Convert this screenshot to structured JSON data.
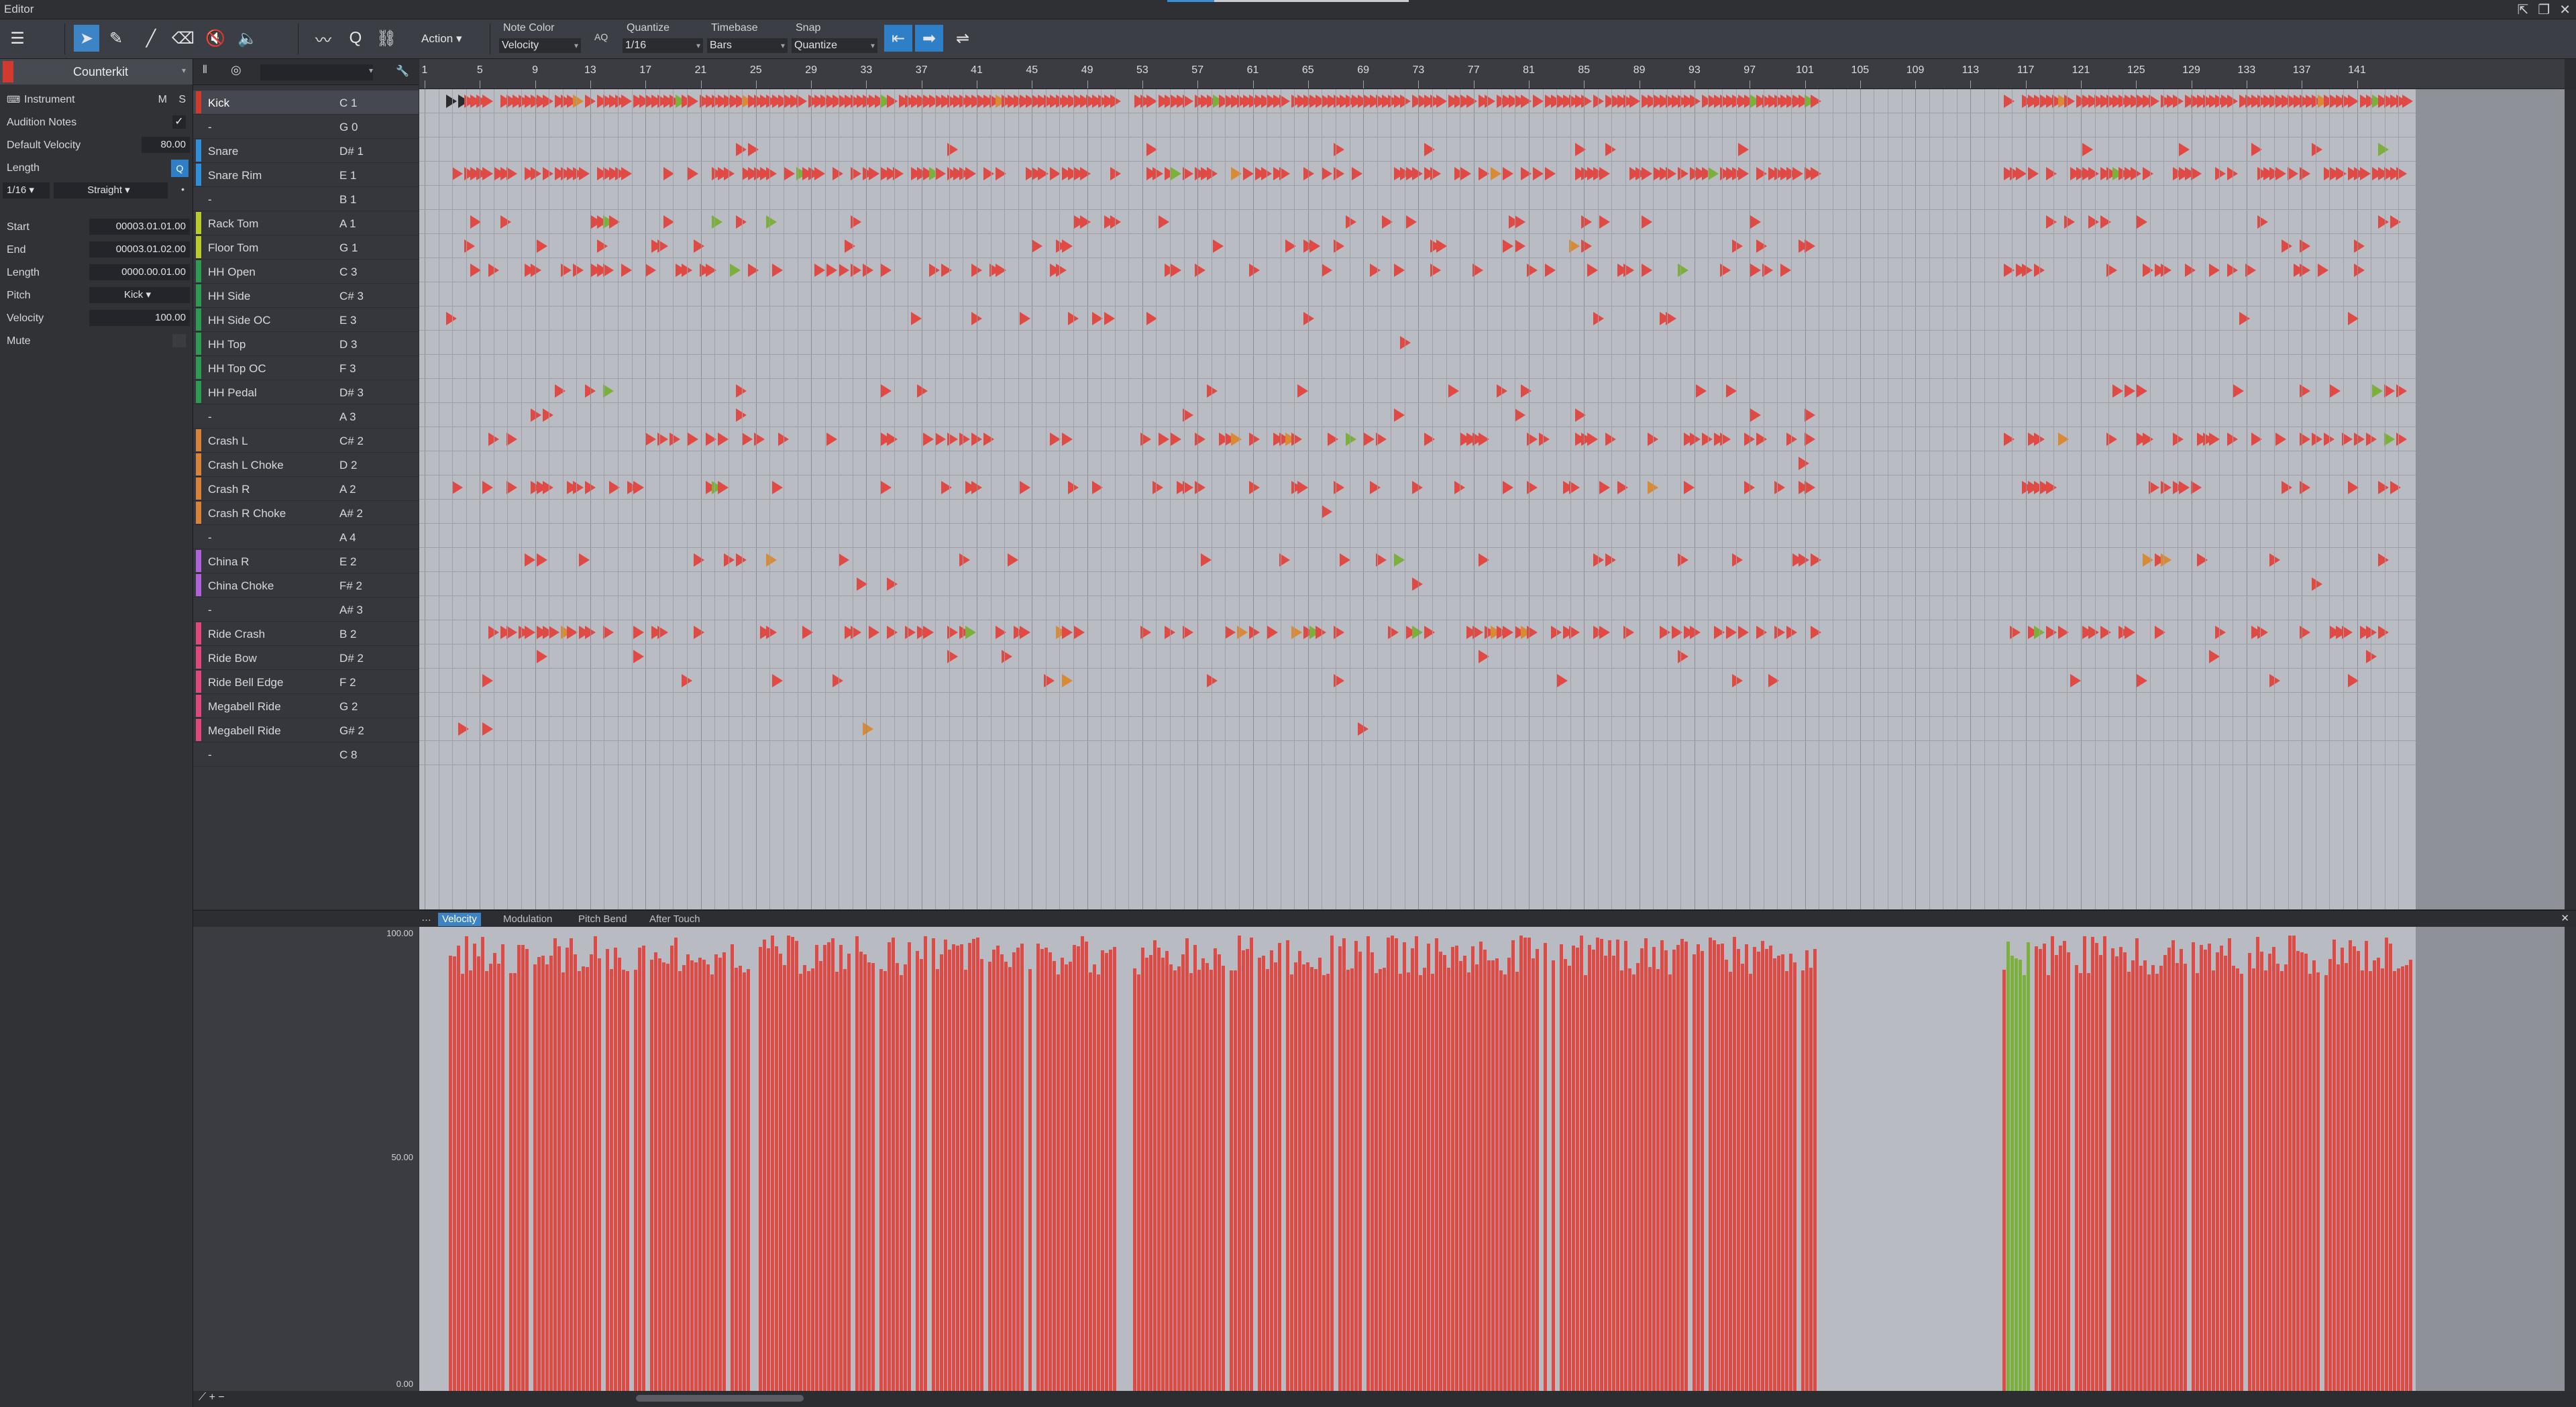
{
  "window": {
    "title": "Editor",
    "controls": [
      "pin-icon",
      "restore-icon",
      "close-icon"
    ]
  },
  "toolbar": {
    "tools": [
      "menu-icon",
      "arrow-tool-icon",
      "pencil-tool-icon",
      "paint-tool-icon",
      "eraser-tool-icon",
      "mute-tool-icon",
      "listen-tool-icon",
      "bend-tool-icon",
      "quantize-icon",
      "split-icon"
    ],
    "action_label": "Action",
    "note_color_label": "Note Color",
    "note_color_value": "Velocity",
    "quantize_badge": "AQ",
    "quantize_label": "Quantize",
    "quantize_value": "1/16",
    "timebase_label": "Timebase",
    "timebase_value": "Bars",
    "snap_label": "Snap",
    "snap_value": "Quantize"
  },
  "inspector": {
    "instrument_name": "Counterkit",
    "instrument_label": "Instrument",
    "m_label": "M",
    "s_label": "S",
    "audition_notes_label": "Audition Notes",
    "default_velocity_label": "Default Velocity",
    "default_velocity_value": "80.00",
    "length_label": "Length",
    "length_grid": "1/16",
    "length_mode": "Straight",
    "start_label": "Start",
    "start_value": "00003.01.01.00",
    "end_label": "End",
    "end_value": "00003.01.02.00",
    "note_length_label": "Length",
    "note_length_value": "0000.00.01.00",
    "pitch_label": "Pitch",
    "pitch_value": "Kick",
    "velocity_label": "Velocity",
    "velocity_value": "100.00",
    "mute_label": "Mute"
  },
  "colors": {
    "accent": "#3c84c6",
    "note": "#e04a45",
    "note_green": "#7bb03a",
    "note_orange": "#d88a34",
    "note_blue": "#6a6ee0"
  },
  "lanes": [
    {
      "name": "Kick",
      "pitch": "C 1",
      "color": "#d23a2e"
    },
    {
      "name": "-",
      "pitch": "G 0",
      "color": ""
    },
    {
      "name": "Snare",
      "pitch": "D# 1",
      "color": "#2f8fd8"
    },
    {
      "name": "Snare Rim",
      "pitch": "E 1",
      "color": "#2f8fd8"
    },
    {
      "name": "-",
      "pitch": "B 1",
      "color": ""
    },
    {
      "name": "Rack Tom",
      "pitch": "A 1",
      "color": "#b9cc2a"
    },
    {
      "name": "Floor Tom",
      "pitch": "G 1",
      "color": "#b9cc2a"
    },
    {
      "name": "HH Open",
      "pitch": "C 3",
      "color": "#2e9a52"
    },
    {
      "name": "HH Side",
      "pitch": "C# 3",
      "color": "#2e9a52"
    },
    {
      "name": "HH Side OC",
      "pitch": "E 3",
      "color": "#2e9a52"
    },
    {
      "name": "HH Top",
      "pitch": "D 3",
      "color": "#2e9a52"
    },
    {
      "name": "HH Top OC",
      "pitch": "F 3",
      "color": "#2e9a52"
    },
    {
      "name": "HH Pedal",
      "pitch": "D# 3",
      "color": "#2e9a52"
    },
    {
      "name": "-",
      "pitch": "A 3",
      "color": ""
    },
    {
      "name": "Crash L",
      "pitch": "C# 2",
      "color": "#d8823a"
    },
    {
      "name": "Crash L Choke",
      "pitch": "D 2",
      "color": "#d8823a"
    },
    {
      "name": "Crash R",
      "pitch": "A 2",
      "color": "#d8823a"
    },
    {
      "name": "Crash R Choke",
      "pitch": "A# 2",
      "color": "#d8823a"
    },
    {
      "name": "-",
      "pitch": "A 4",
      "color": ""
    },
    {
      "name": "China R",
      "pitch": "E 2",
      "color": "#b062d8"
    },
    {
      "name": "China Choke",
      "pitch": "F# 2",
      "color": "#b062d8"
    },
    {
      "name": "-",
      "pitch": "A# 3",
      "color": ""
    },
    {
      "name": "Ride Crash",
      "pitch": "B 2",
      "color": "#e0487c"
    },
    {
      "name": "Ride Bow",
      "pitch": "D# 2",
      "color": "#e0487c"
    },
    {
      "name": "Ride Bell Edge",
      "pitch": "F 2",
      "color": "#e0487c"
    },
    {
      "name": "Megabell Ride",
      "pitch": "G 2",
      "color": "#e0487c"
    },
    {
      "name": "Megabell Ride",
      "pitch": "G# 2",
      "color": "#e0487c"
    },
    {
      "name": "-",
      "pitch": "C 8",
      "color": ""
    }
  ],
  "ruler": {
    "bars": [
      "1",
      "5",
      "9",
      "13",
      "17",
      "21",
      "25",
      "29",
      "33",
      "37",
      "41",
      "45",
      "49",
      "53",
      "57",
      "61",
      "65",
      "69",
      "73",
      "77",
      "81",
      "85",
      "89",
      "93",
      "97",
      "101",
      "105",
      "109",
      "113",
      "117",
      "121",
      "125",
      "129",
      "133",
      "137",
      "141"
    ]
  },
  "automation": {
    "tabs": [
      "Velocity",
      "Modulation",
      "Pitch Bend",
      "After Touch"
    ],
    "active_tab": "Velocity",
    "scale": {
      "max": "100.00",
      "mid": "50.00",
      "min": "0.00"
    }
  }
}
